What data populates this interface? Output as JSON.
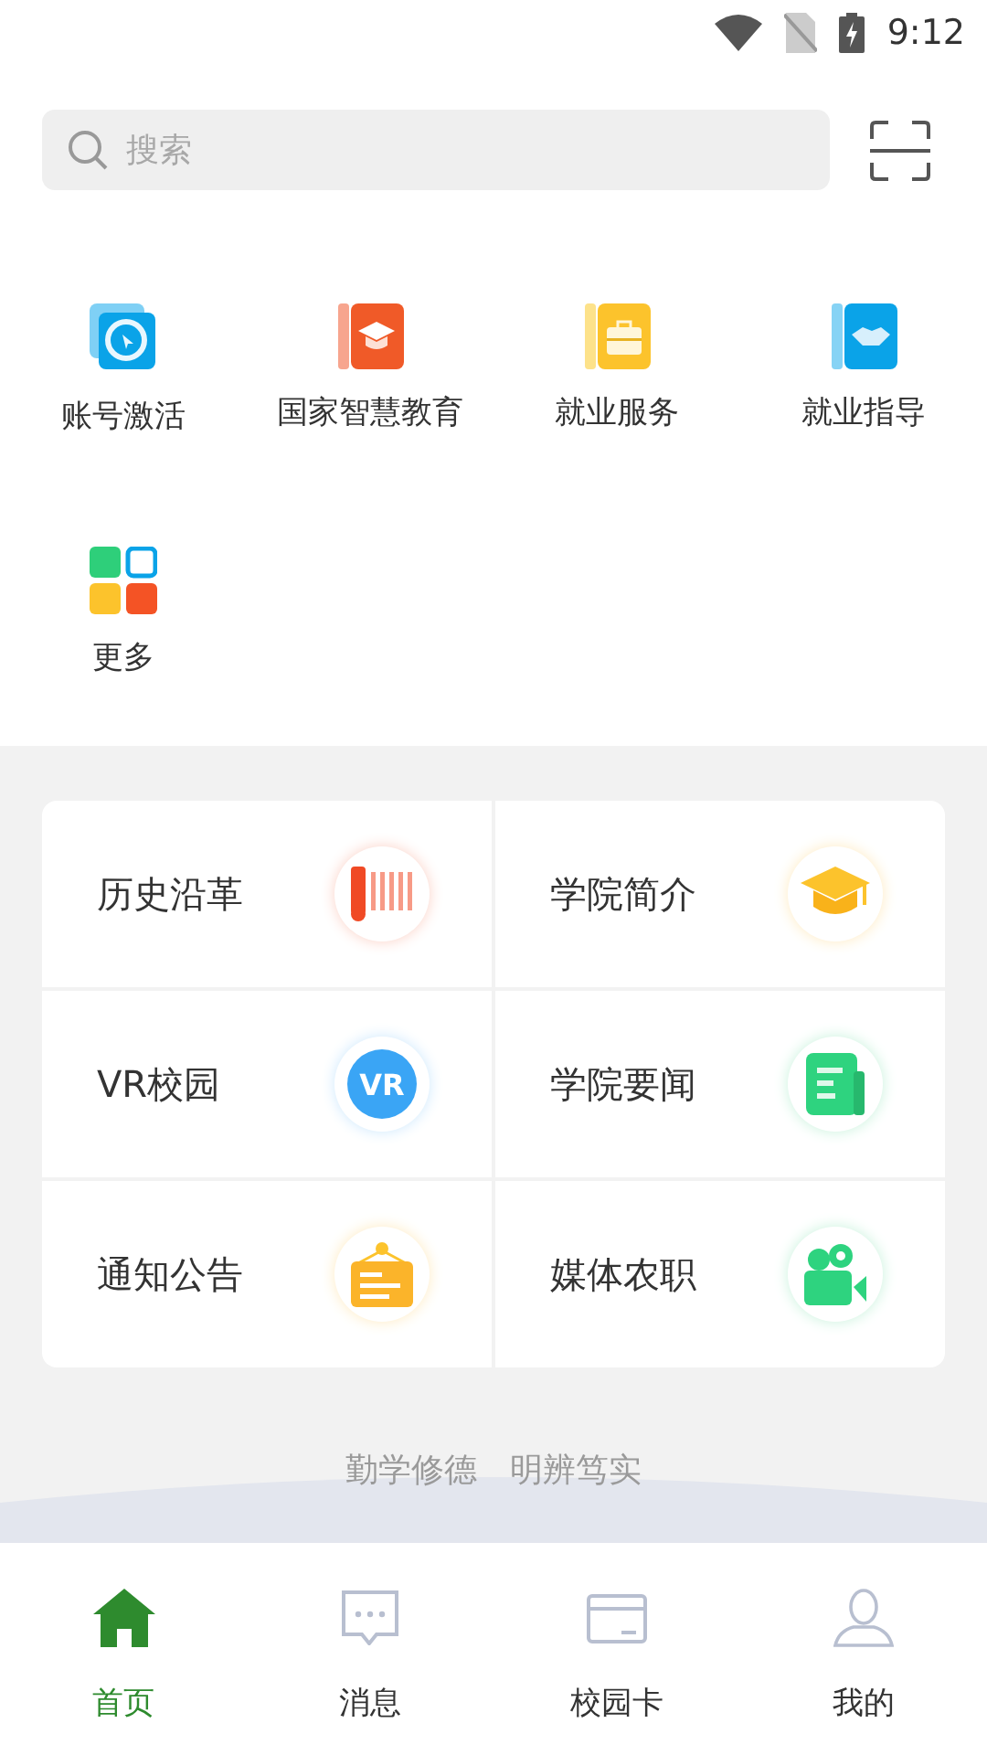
{
  "status_bar": {
    "time": "9:12"
  },
  "search": {
    "placeholder": "搜索"
  },
  "shortcuts": [
    {
      "label": "账号激活"
    },
    {
      "label": "国家智慧教育"
    },
    {
      "label": "就业服务"
    },
    {
      "label": "就业指导"
    },
    {
      "label": "更多"
    }
  ],
  "features": [
    {
      "label": "历史沿革"
    },
    {
      "label": "学院简介"
    },
    {
      "label": "VR校园",
      "icon_text": "VR"
    },
    {
      "label": "学院要闻"
    },
    {
      "label": "通知公告"
    },
    {
      "label": "媒体农职"
    }
  ],
  "motto": "勤学修德　明辨笃实",
  "bottom_nav": [
    {
      "label": "首页",
      "selected": true
    },
    {
      "label": "消息",
      "selected": false
    },
    {
      "label": "校园卡",
      "selected": false
    },
    {
      "label": "我的",
      "selected": false
    }
  ]
}
